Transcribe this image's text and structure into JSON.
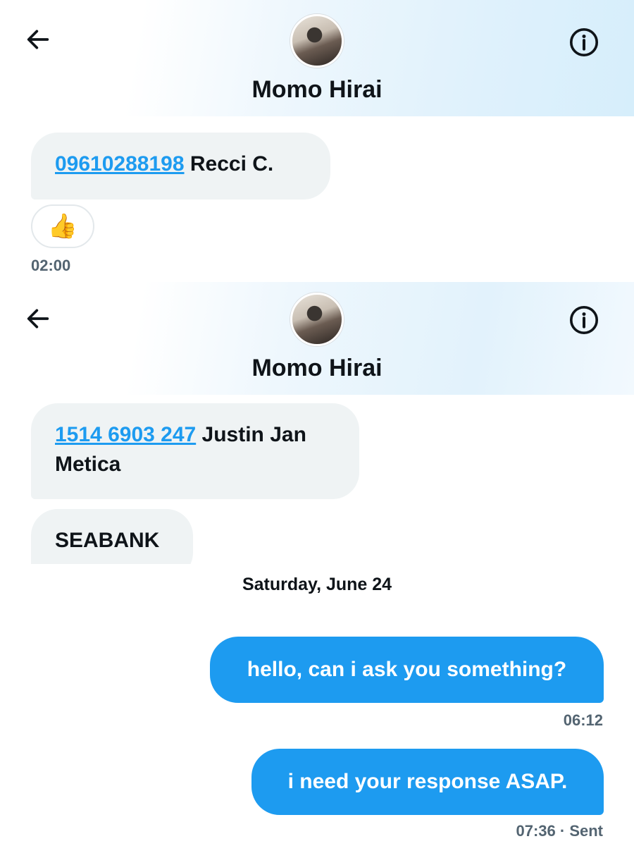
{
  "screens": [
    {
      "contact_name": "Momo Hirai",
      "back_icon": "arrow-left-icon",
      "info_icon": "info-circle-icon"
    },
    {
      "contact_name": "Momo Hirai",
      "back_icon": "arrow-left-icon",
      "info_icon": "info-circle-icon"
    }
  ],
  "messages_top": {
    "msg1": {
      "link": "09610288198",
      "text": " Recci C."
    },
    "reaction_emoji": "👍",
    "time": "02:00"
  },
  "messages_bottom": {
    "msg1": {
      "link": "1514 6903 247",
      "text_line1": " Justin Jan",
      "text_line2": "Metica"
    },
    "msg2": {
      "text": "SEABANK"
    },
    "date_separator": "Saturday, June 24",
    "out1": {
      "text": "hello, can i ask you something?",
      "time": "06:12"
    },
    "out2": {
      "text": "i need your response ASAP.",
      "time": "07:36",
      "status": " · Sent"
    }
  },
  "colors": {
    "accent": "#1d9bf0",
    "incoming_bubble": "#eff3f4",
    "muted_text": "#536471"
  }
}
